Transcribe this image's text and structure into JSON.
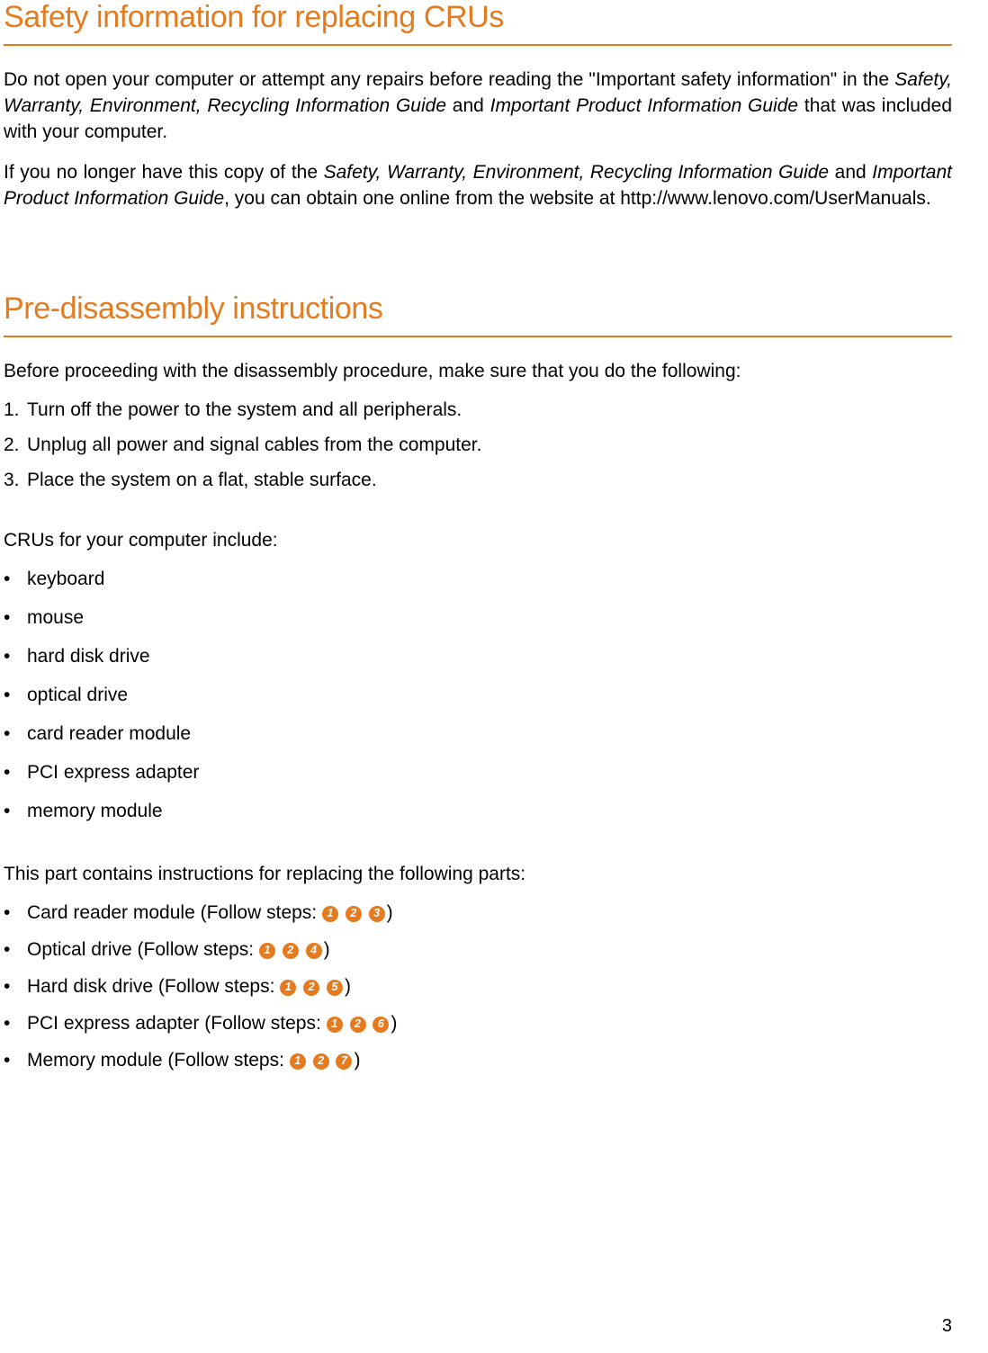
{
  "section1": {
    "heading": "Safety information for replacing CRUs",
    "para1_parts": {
      "t1": "Do not open your computer or attempt any repairs before reading the \"Important safety information\" in the ",
      "i1": "Safety, Warranty, Environment, Recycling Information Guide",
      "t2": " and ",
      "i2": "Important Product Information Guide",
      "t3": " that was included with your computer."
    },
    "para2_parts": {
      "t1": "If you no longer have this copy of the ",
      "i1": "Safety, Warranty, Environment, Recycling Information Guide",
      "t2": " and ",
      "i2": "Important Product Information Guide",
      "t3": ", you can obtain one online from the website at http://www.lenovo.com/UserManuals."
    }
  },
  "section2": {
    "heading": "Pre-disassembly instructions",
    "intro": "Before proceeding with the disassembly procedure, make sure that you do the following:",
    "steps": [
      {
        "marker": "1.",
        "text": "Turn off the power to the system and all peripherals."
      },
      {
        "marker": "2.",
        "text": "Unplug all power and signal cables from the computer."
      },
      {
        "marker": "3.",
        "text": "Place the system on a flat, stable surface."
      }
    ],
    "cru_intro": "CRUs for your computer include:",
    "crus": [
      "keyboard",
      "mouse",
      "hard disk drive",
      "optical drive",
      "card reader module",
      "PCI express adapter",
      "memory module"
    ],
    "parts_intro": "This part contains instructions for replacing the following parts:",
    "follow_prefix": " (Follow steps: ",
    "follow_suffix": ")",
    "parts": [
      {
        "name": "Card reader module",
        "badges": [
          "1",
          "2",
          "3"
        ]
      },
      {
        "name": "Optical drive",
        "badges": [
          "1",
          "2",
          "4"
        ]
      },
      {
        "name": "Hard disk drive",
        "badges": [
          "1",
          "2",
          "5"
        ]
      },
      {
        "name": "PCI express adapter",
        "badges": [
          "1",
          "2",
          "6"
        ]
      },
      {
        "name": "Memory module",
        "badges": [
          "1",
          "2",
          "7"
        ]
      }
    ]
  },
  "page_number": "3"
}
